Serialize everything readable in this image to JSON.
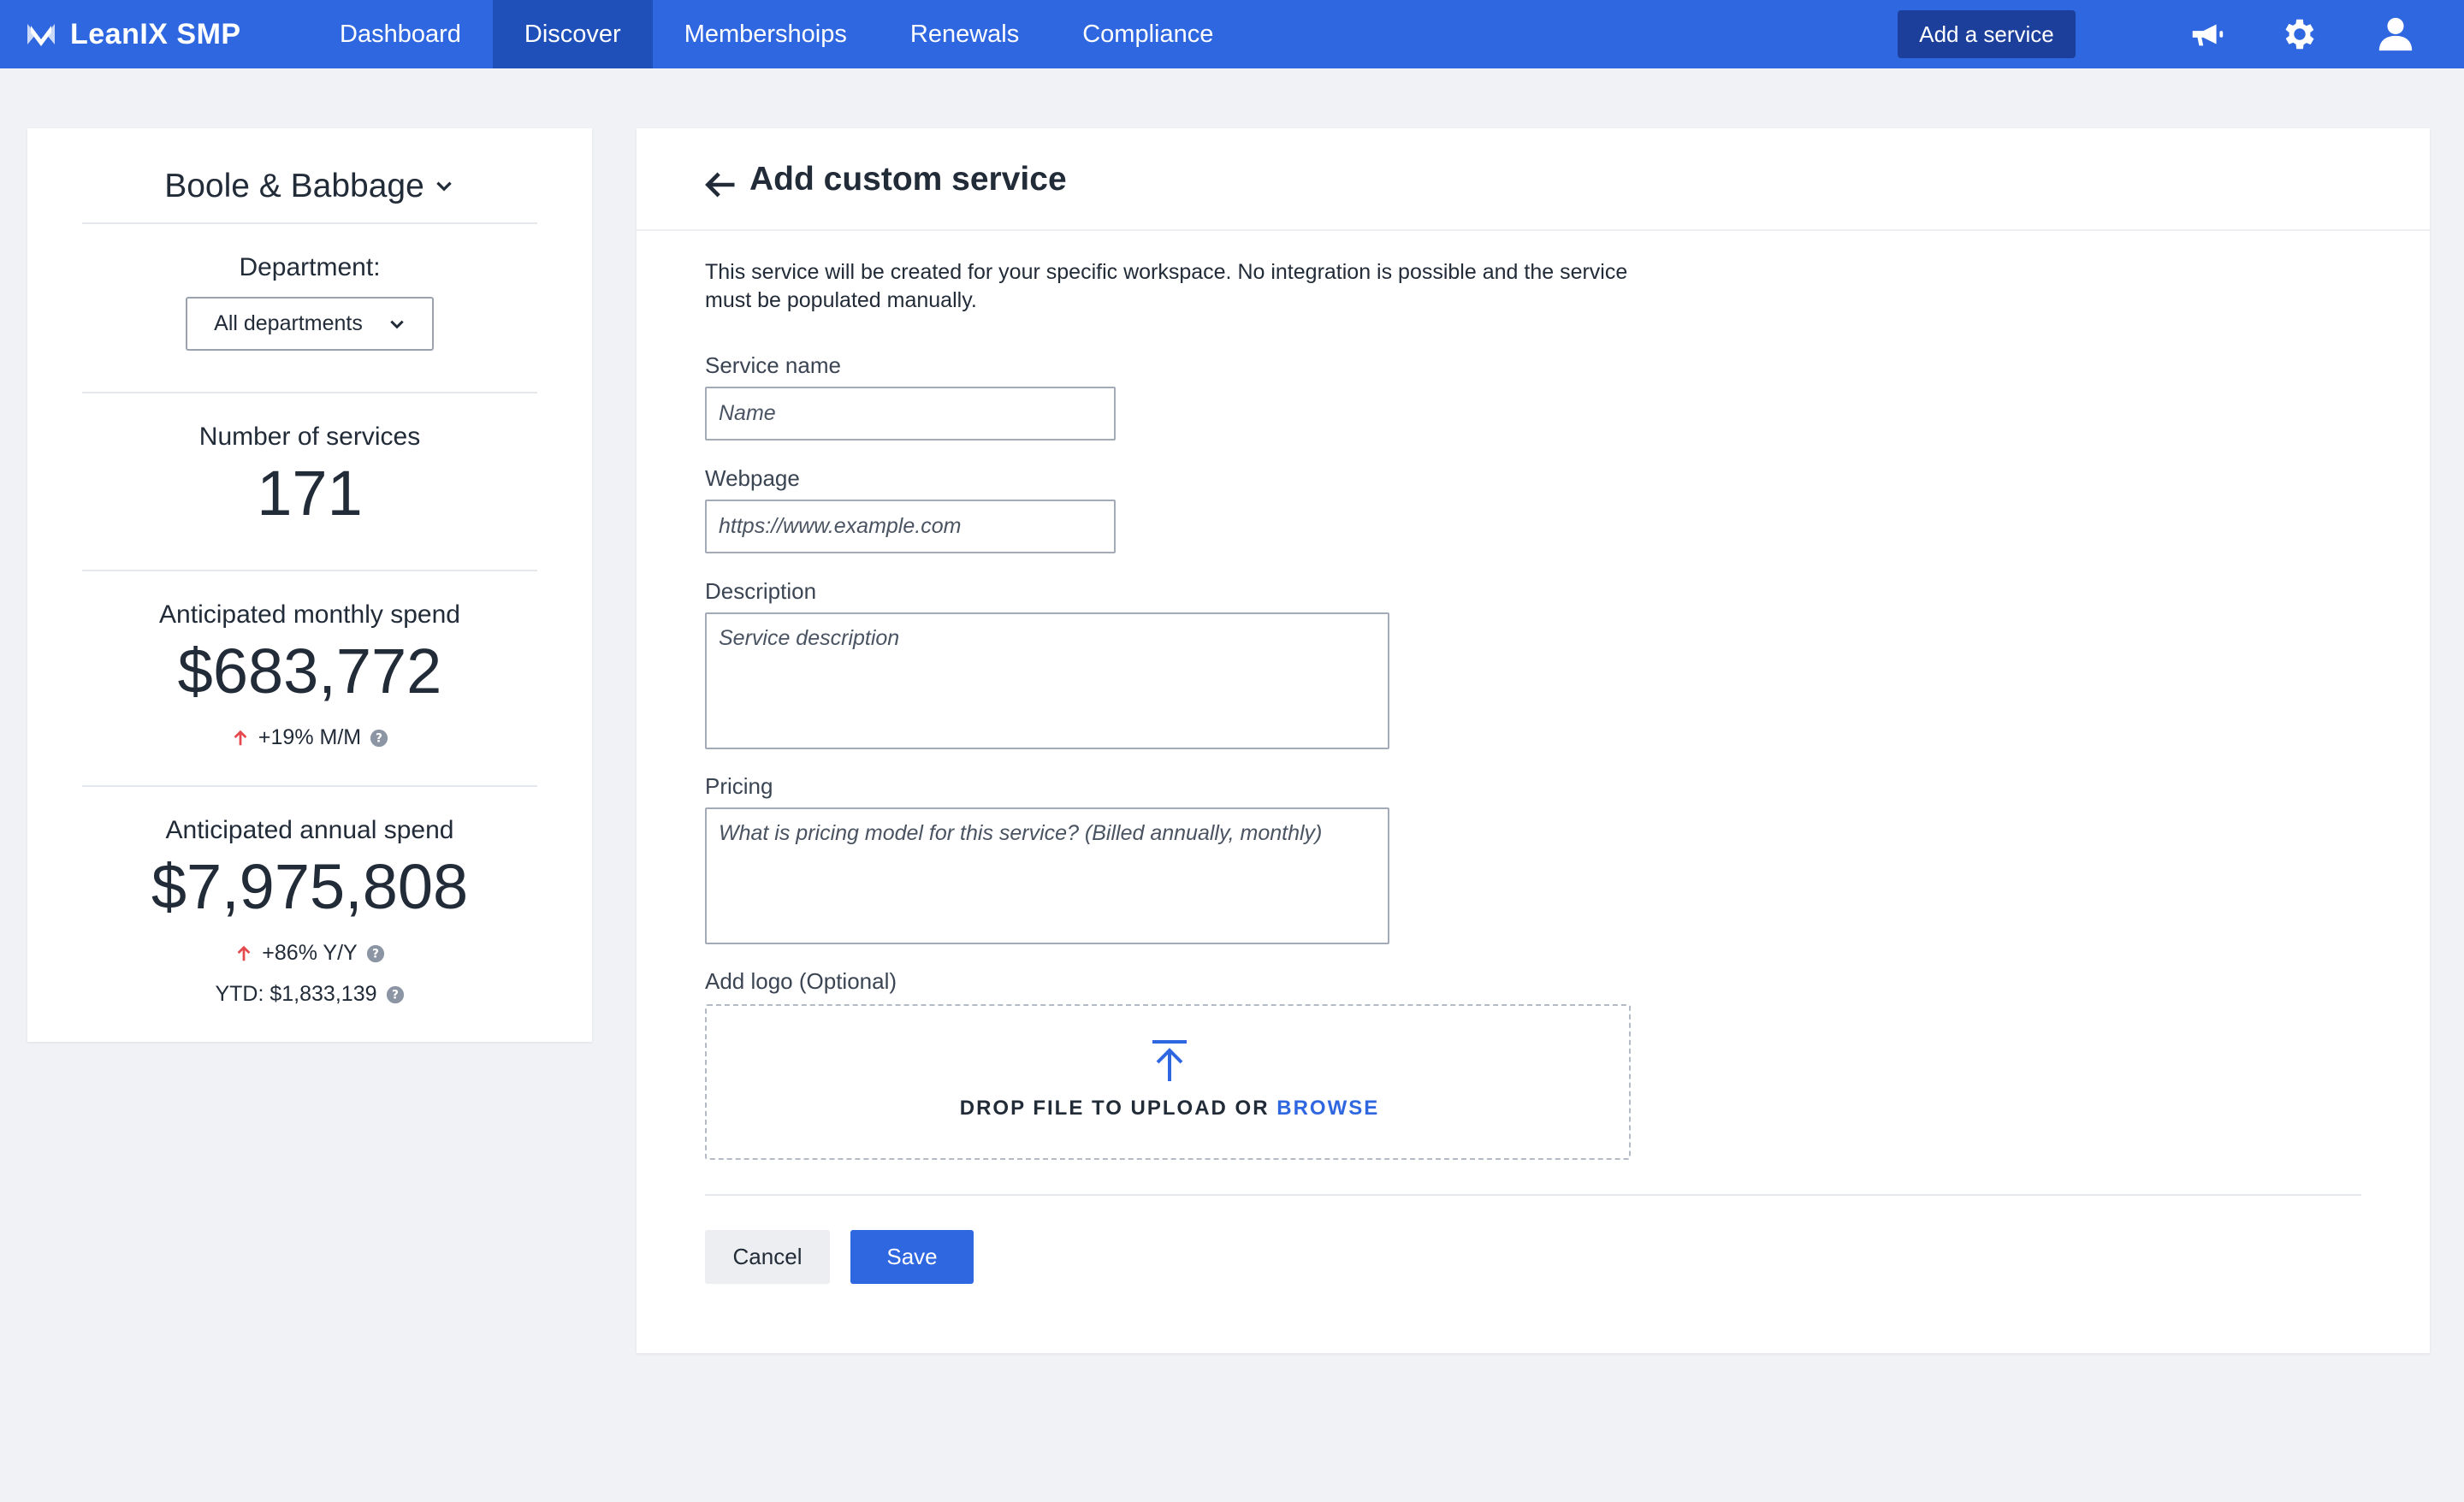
{
  "navbar": {
    "brand": "LeanIX SMP",
    "tabs": [
      {
        "label": "Dashboard"
      },
      {
        "label": "Discover"
      },
      {
        "label": "Membershoips"
      },
      {
        "label": "Renewals"
      },
      {
        "label": "Compliance"
      }
    ],
    "active_tab": "Discover",
    "add_service_label": "Add a service",
    "brand_color": "#2f67e0"
  },
  "sidebar": {
    "workspace": "Boole & Babbage",
    "department_label": "Department:",
    "department_selected": "All departments",
    "services_label": "Number of services",
    "services_count": "171",
    "monthly_label": "Anticipated monthly spend",
    "monthly_value": "$683,772",
    "monthly_trend": "+19% M/M",
    "annual_label": "Anticipated annual spend",
    "annual_value": "$7,975,808",
    "annual_trend": "+86% Y/Y",
    "ytd": "YTD: $1,833,139",
    "trend_up_color": "#e5484d"
  },
  "form": {
    "title": "Add custom service",
    "intro_line1": "This service will be created for your specific workspace. No integration is possible and the service",
    "intro_line2": "must be populated manually.",
    "service_name_label": "Service name",
    "service_name_placeholder": "Name",
    "webpage_label": "Webpage",
    "webpage_placeholder": "https://www.example.com",
    "description_label": "Description",
    "description_placeholder": "Service description",
    "pricing_label": "Pricing",
    "pricing_placeholder": "What is pricing model for this service? (Billed annually, monthly)",
    "logo_label": "Add logo (Optional)",
    "drop_text": "DROP FILE TO UPLOAD OR",
    "browse_label": "BROWSE",
    "cancel_label": "Cancel",
    "save_label": "Save"
  }
}
